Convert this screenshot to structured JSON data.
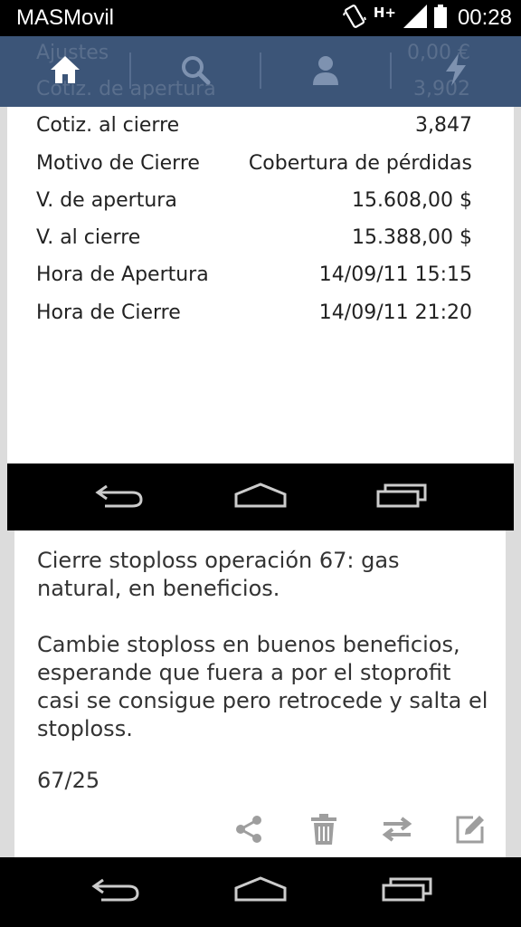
{
  "status_bar": {
    "carrier": "MASMovil",
    "network": "H+",
    "time": "00:28",
    "icons": [
      "vibrate-icon",
      "signal-icon",
      "battery-icon"
    ]
  },
  "background": {
    "ghost_rows": [
      {
        "label": "Ajustes",
        "value": "0,00 €"
      },
      {
        "label": "Cotiz. de apertura",
        "value": "3,902"
      }
    ],
    "tabs": [
      {
        "name": "home",
        "icon": "home-icon",
        "active": true
      },
      {
        "name": "search",
        "icon": "search-icon"
      },
      {
        "name": "profile",
        "icon": "person-icon"
      },
      {
        "name": "alerts",
        "icon": "lightning-icon"
      }
    ]
  },
  "detail": {
    "rows": [
      {
        "label": "Cotiz. al cierre",
        "value": "3,847"
      },
      {
        "label": "Motivo de Cierre",
        "value": "Cobertura de pérdidas"
      },
      {
        "label": "V. de apertura",
        "value": "15.608,00 $"
      },
      {
        "label": "V. al cierre",
        "value": "15.388,00 $"
      },
      {
        "label": "Hora de Apertura",
        "value": "14/09/11 15:15"
      },
      {
        "label": "Hora de Cierre",
        "value": "14/09/11 21:20"
      }
    ]
  },
  "note": {
    "text": "Cierre stoploss operación 67: gas natural, en beneficios.\n\nCambie stoploss en buenos beneficios, esperande que fuera a por el stoprofit casi se consigue pero retrocede y salta el stoploss.",
    "count": "67/25",
    "actions": [
      "share-icon",
      "trash-icon",
      "repost-icon",
      "edit-icon"
    ]
  },
  "navigation": [
    "back-icon",
    "home-icon",
    "recents-icon"
  ],
  "colors": {
    "tabbar": "#3c5578",
    "card": "#ffffff",
    "text": "#222222",
    "action_icon": "#9e9e9e"
  }
}
